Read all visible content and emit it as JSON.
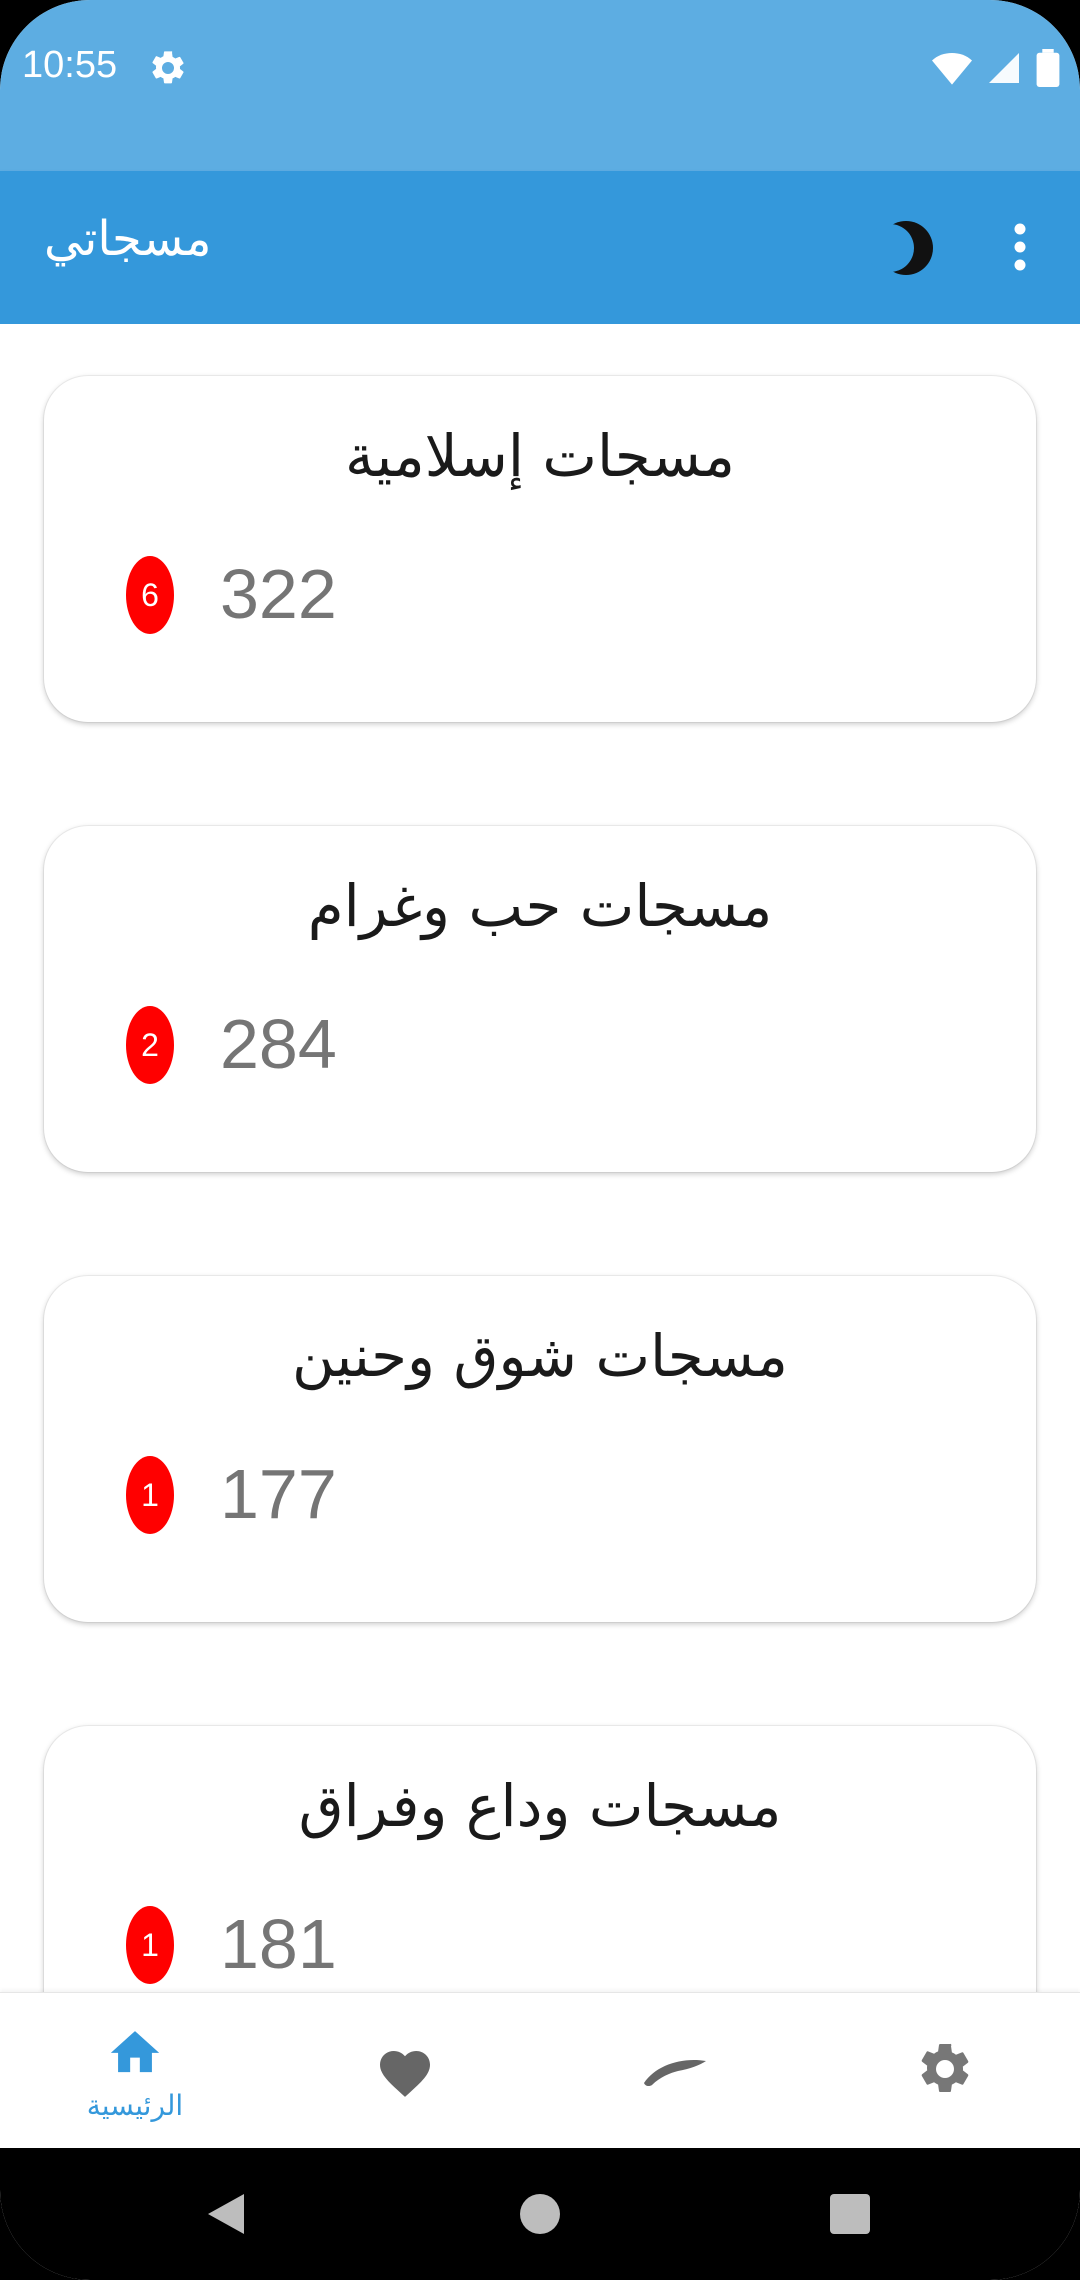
{
  "status_bar": {
    "time": "10:55",
    "icons": [
      "gear-icon",
      "wifi-icon",
      "signal-icon",
      "battery-icon"
    ]
  },
  "app_bar": {
    "title": "مسجاتي",
    "actions": [
      "moon-icon",
      "more-vert-icon"
    ]
  },
  "categories": [
    {
      "title": "مسجات إسلامية",
      "count": "322",
      "badge": "6"
    },
    {
      "title": "مسجات حب وغرام",
      "count": "284",
      "badge": "2"
    },
    {
      "title": "مسجات شوق وحنين",
      "count": "177",
      "badge": "1"
    },
    {
      "title": "مسجات وداع وفراق",
      "count": "181",
      "badge": "1"
    }
  ],
  "bottom_nav": {
    "items": [
      {
        "icon": "home-icon",
        "label": "الرئيسية",
        "active": true
      },
      {
        "icon": "heart-icon",
        "label": ""
      },
      {
        "icon": "feather-icon",
        "label": ""
      },
      {
        "icon": "settings-icon",
        "label": ""
      }
    ]
  },
  "colors": {
    "status_bar": "#5DADE2",
    "app_bar": "#3498DB",
    "badge": "#FF0000",
    "accent": "#3498DB",
    "inactive_icon": "#757575"
  },
  "system_nav": [
    "back-icon",
    "home-circle-icon",
    "recents-icon"
  ]
}
